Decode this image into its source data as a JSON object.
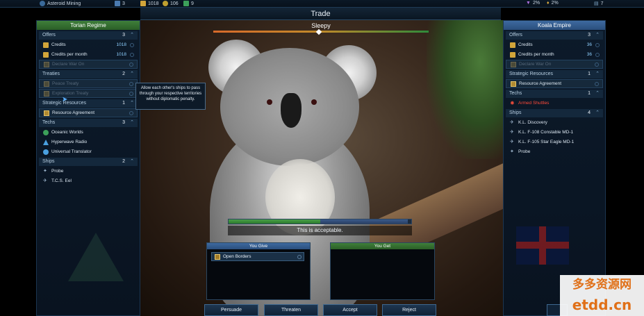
{
  "topbar": {
    "location": "Asteroid Mining",
    "counter": "3",
    "credits": "1018",
    "resource2": "106",
    "resource3": "9",
    "right1": "2%",
    "right2": "2%",
    "right3": "7"
  },
  "title": "Trade",
  "mood": {
    "label": "Sleepy",
    "level": 0.49
  },
  "left_panel": {
    "name": "Torian Regime",
    "sections": [
      {
        "label": "Offers",
        "count": "3",
        "items": [
          {
            "label": "Credits",
            "value": "1018",
            "icon": "credits-icon"
          },
          {
            "label": "Credits per month",
            "value": "1018",
            "icon": "credits-icon"
          },
          {
            "label": "Declare War On",
            "icon": "document-icon",
            "disabled": true
          }
        ]
      },
      {
        "label": "Treaties",
        "count": "2",
        "items": [
          {
            "label": "Peace Treaty",
            "icon": "document-icon",
            "disabled": true
          },
          {
            "label": "Exploration Treaty",
            "icon": "document-icon",
            "disabled": true
          }
        ]
      },
      {
        "label": "Strategic Resources",
        "count": "1",
        "items": [
          {
            "label": "Resource Agreement",
            "icon": "resource-icon"
          }
        ]
      },
      {
        "label": "Techs",
        "count": "3",
        "items": [
          {
            "label": "Oceanic Worlds",
            "icon": "globe-icon"
          },
          {
            "label": "Hyperwave Radio",
            "icon": "pyramid-icon"
          },
          {
            "label": "Universal Translator",
            "icon": "bubble-icon"
          }
        ]
      },
      {
        "label": "Ships",
        "count": "2",
        "items": [
          {
            "label": "Probe",
            "icon": "probe-icon"
          },
          {
            "label": "T.C.S. Eel",
            "icon": "ship-icon"
          }
        ]
      }
    ]
  },
  "right_panel": {
    "name": "Koala Empire",
    "sections": [
      {
        "label": "Offers",
        "count": "3",
        "items": [
          {
            "label": "Credits",
            "value": "36",
            "icon": "credits-icon"
          },
          {
            "label": "Credits per month",
            "value": "36",
            "icon": "credits-icon"
          },
          {
            "label": "Declare War On",
            "icon": "document-icon",
            "disabled": true
          }
        ]
      },
      {
        "label": "Strategic Resources",
        "count": "1",
        "items": [
          {
            "label": "Resource Agreement",
            "icon": "resource-icon"
          }
        ]
      },
      {
        "label": "Techs",
        "count": "1",
        "items": [
          {
            "label": "Armed Shuttles",
            "icon": "gear-icon",
            "red": true
          }
        ]
      },
      {
        "label": "Ships",
        "count": "4",
        "items": [
          {
            "label": "K.L. Discovery",
            "icon": "ship-icon"
          },
          {
            "label": "K.L. F-108 Constable MD-1",
            "icon": "ship-icon"
          },
          {
            "label": "K.L. F-105 Star Eagle MD-1",
            "icon": "ship-icon"
          },
          {
            "label": "Probe",
            "icon": "probe-icon"
          }
        ]
      }
    ]
  },
  "tooltip": "Allow each other's ships to pass through your respective territories without diplomatic penalty.",
  "acceptance": {
    "text": "This is acceptable.",
    "progress": 0.5
  },
  "you_give": {
    "label": "You Give",
    "items": [
      "Open Borders"
    ]
  },
  "you_get": {
    "label": "You Get",
    "items": []
  },
  "buttons": {
    "persuade": "Persuade",
    "threaten": "Threaten",
    "accept": "Accept",
    "reject": "Reject"
  },
  "watermark": {
    "line1": "多多资源网",
    "line2": "etdd.cn"
  },
  "colors": {
    "player_green": "#3f7f3a",
    "ai_blue": "#3e6aa0",
    "accent": "#8fd0ff",
    "warning_red": "#ff4a3a"
  }
}
